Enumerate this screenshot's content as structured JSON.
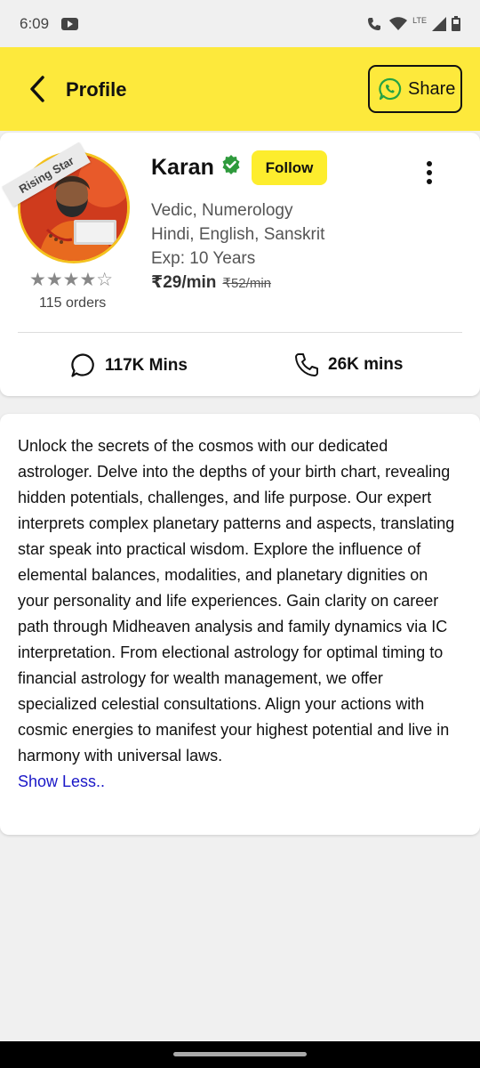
{
  "status_bar": {
    "time": "6:09",
    "network": "LTE",
    "icons": [
      "youtube-icon",
      "wifi-calling-icon",
      "wifi-icon",
      "signal-icon",
      "battery-icon"
    ]
  },
  "app_bar": {
    "title": "Profile",
    "share_label": "Share",
    "background": "#fde93c"
  },
  "profile": {
    "badge": "Rising Star",
    "name": "Karan",
    "follow_label": "Follow",
    "skills": "Vedic, Numerology",
    "languages": "Hindi, English, Sanskrit",
    "experience": "Exp: 10 Years",
    "price": "₹29/min",
    "old_price": "₹52/min",
    "rating": 4,
    "rating_max": 5,
    "rating_stars": "★★★★☆",
    "orders": "115 orders",
    "chat_minutes": "117K Mins",
    "call_minutes": "26K mins"
  },
  "about": {
    "text": "Unlock the secrets of the cosmos with our dedicated astrologer. Delve into the depths of your birth chart, revealing hidden potentials, challenges, and life purpose. Our expert interprets complex planetary patterns and aspects, translating star speak into practical wisdom. Explore the influence of elemental balances, modalities, and planetary dignities on your personality and life experiences. Gain clarity on career path through Midheaven analysis and family dynamics via IC interpretation. From electional astrology for optimal timing to financial astrology for wealth management, we offer specialized celestial consultations. Align your actions with cosmic energies to manifest your highest potential and live in harmony with universal laws.",
    "show_less_label": "Show Less.."
  },
  "colors": {
    "accent_yellow": "#fde93c",
    "verified_green": "#2e9a3c",
    "link_blue": "#1a17c7",
    "whatsapp_green": "#25a244"
  }
}
